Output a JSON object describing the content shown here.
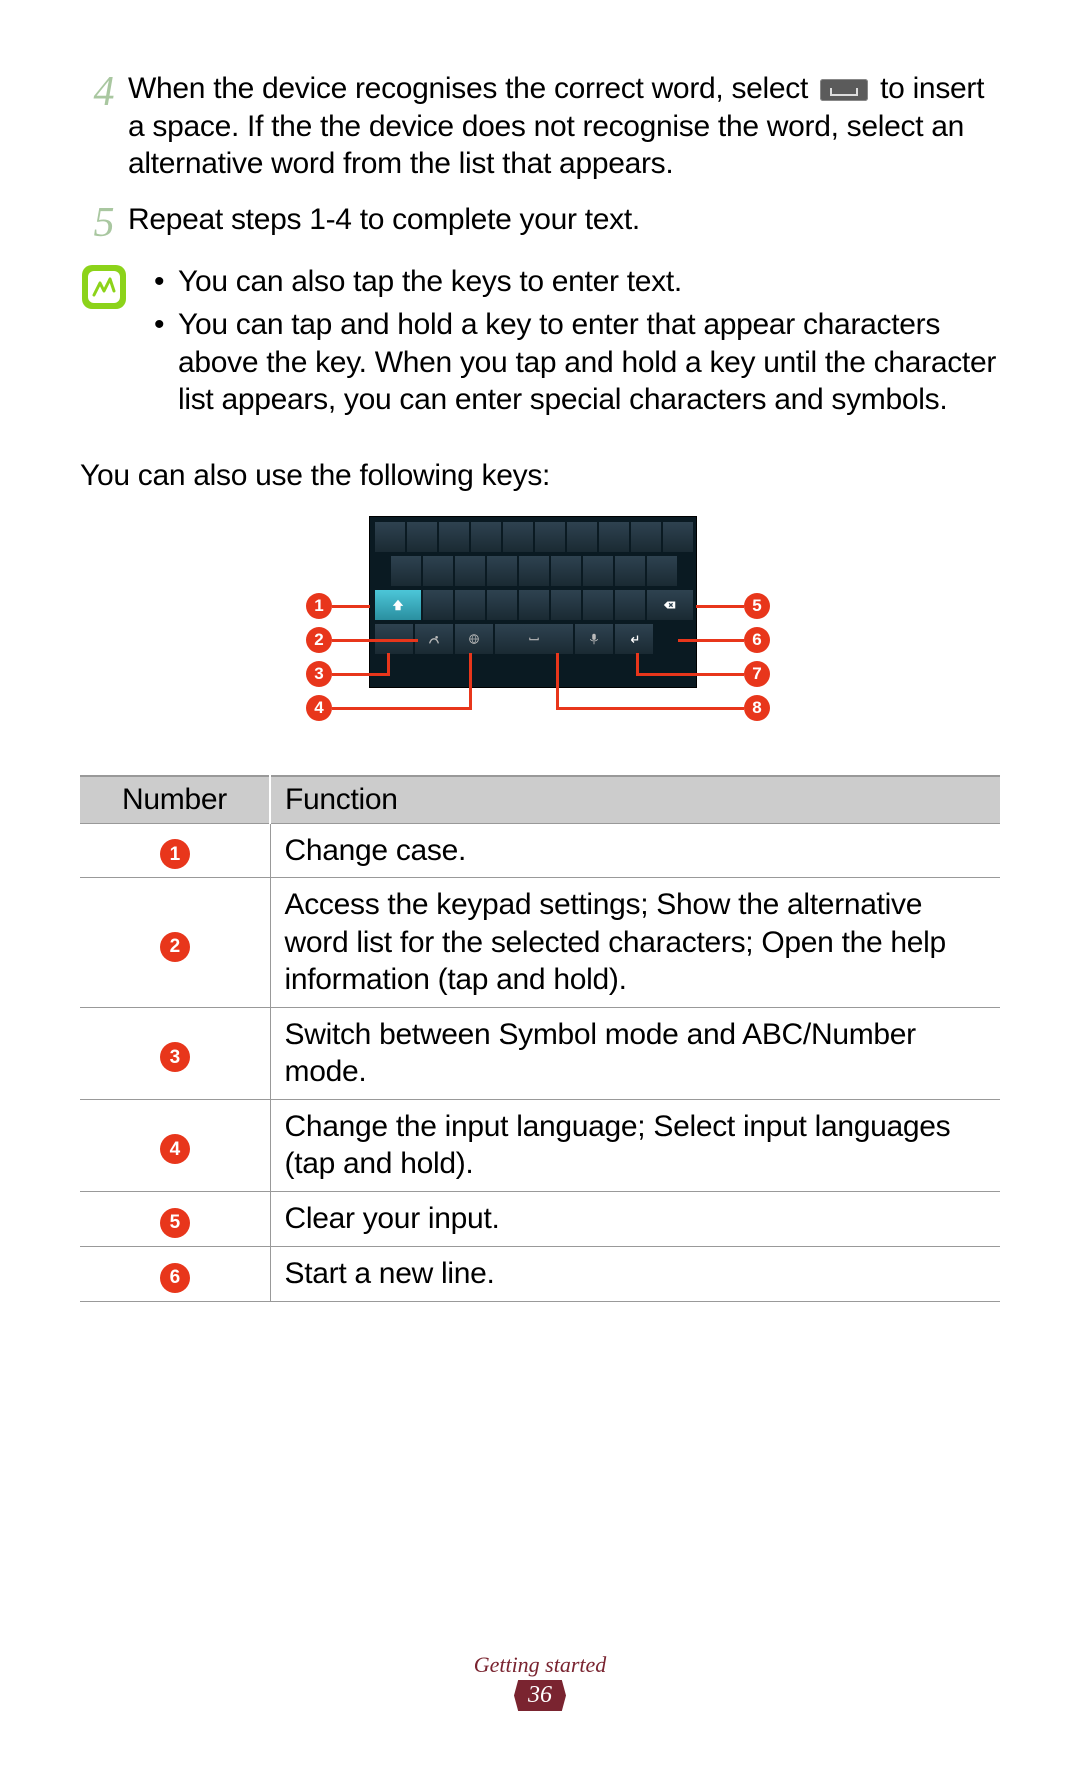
{
  "steps": {
    "s4_num": "4",
    "s4_text_a": "When the device recognises the correct word, select ",
    "s4_text_b": " to insert a space. If the the device does not recognise the word, select an alternative word from the list that appears.",
    "s5_num": "5",
    "s5_text": "Repeat steps 1-4 to complete your text."
  },
  "note": {
    "bullet1": "You can also tap the keys to enter text.",
    "bullet2": "You can tap and hold a key to enter that appear characters above the key. When you tap and hold a key until the character list appears, you can enter special characters and symbols."
  },
  "also_use": "You can also use the following keys:",
  "callouts": {
    "c1": "1",
    "c2": "2",
    "c3": "3",
    "c4": "4",
    "c5": "5",
    "c6": "6",
    "c7": "7",
    "c8": "8"
  },
  "table": {
    "header_num": "Number",
    "header_func": "Function",
    "rows": [
      {
        "n": "1",
        "f": "Change case."
      },
      {
        "n": "2",
        "f": "Access the keypad settings; Show the alternative word list for the selected characters; Open the help information (tap and hold)."
      },
      {
        "n": "3",
        "f": "Switch between Symbol mode and ABC/Number mode."
      },
      {
        "n": "4",
        "f": "Change the input language; Select input languages (tap and hold)."
      },
      {
        "n": "5",
        "f": "Clear your input."
      },
      {
        "n": "6",
        "f": "Start a new line."
      }
    ]
  },
  "footer": {
    "section": "Getting started",
    "page": "36"
  }
}
